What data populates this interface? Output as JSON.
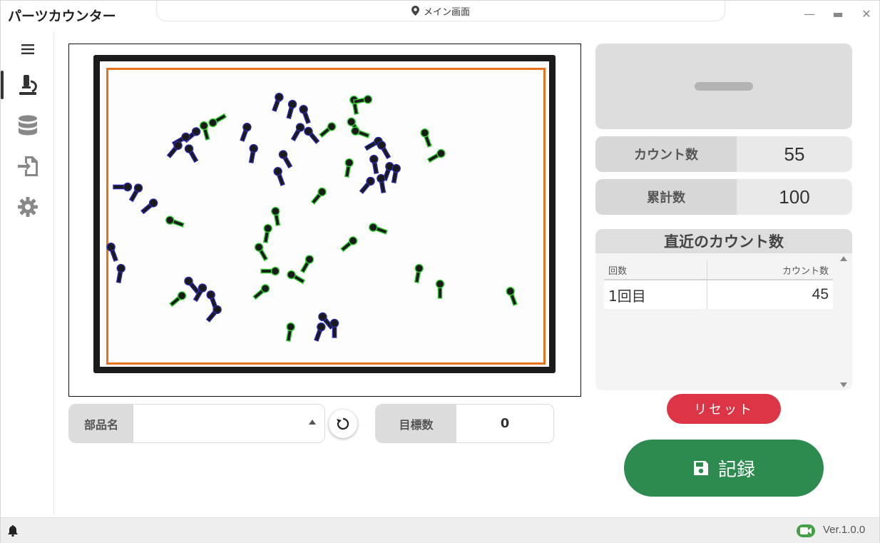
{
  "window": {
    "title": "パーツカウンター",
    "location_label": "メイン画面",
    "minimize_glyph": "—",
    "maximize_glyph": "▬",
    "close_glyph": "✕"
  },
  "sidebar": {
    "items": [
      {
        "name": "menu",
        "icon": "hamburger-icon"
      },
      {
        "name": "camera-inspection",
        "icon": "microscope-icon",
        "active": true
      },
      {
        "name": "database",
        "icon": "database-icon"
      },
      {
        "name": "export",
        "icon": "file-import-icon"
      },
      {
        "name": "settings",
        "icon": "gear-icon"
      }
    ]
  },
  "camera": {
    "part_colors": {
      "counted": "#33cc33",
      "grouped": "#2a2aa8",
      "part": "#1a1a1a"
    },
    "tray_colors": {
      "frame": "#1b1b1b",
      "boundary": "#e8721c"
    }
  },
  "controls": {
    "part_name_label": "部品名",
    "part_name_value": "",
    "target_label": "目標数",
    "target_value": "0",
    "refresh_icon": "refresh-icon"
  },
  "stats": {
    "count_label": "カウント数",
    "count_value": "55",
    "total_label": "累計数",
    "total_value": "100"
  },
  "recent": {
    "title": "直近のカウント数",
    "columns": [
      "回数",
      "カウント数"
    ],
    "rows": [
      {
        "round": "1回目",
        "count": "45"
      }
    ]
  },
  "buttons": {
    "reset_label": "リセット",
    "reset_color": "#dc3545",
    "record_label": "記録",
    "record_color": "#2e8b50",
    "record_icon": "save-icon"
  },
  "status": {
    "version": "Ver.1.0.0",
    "camera_status_color": "#43a047"
  }
}
